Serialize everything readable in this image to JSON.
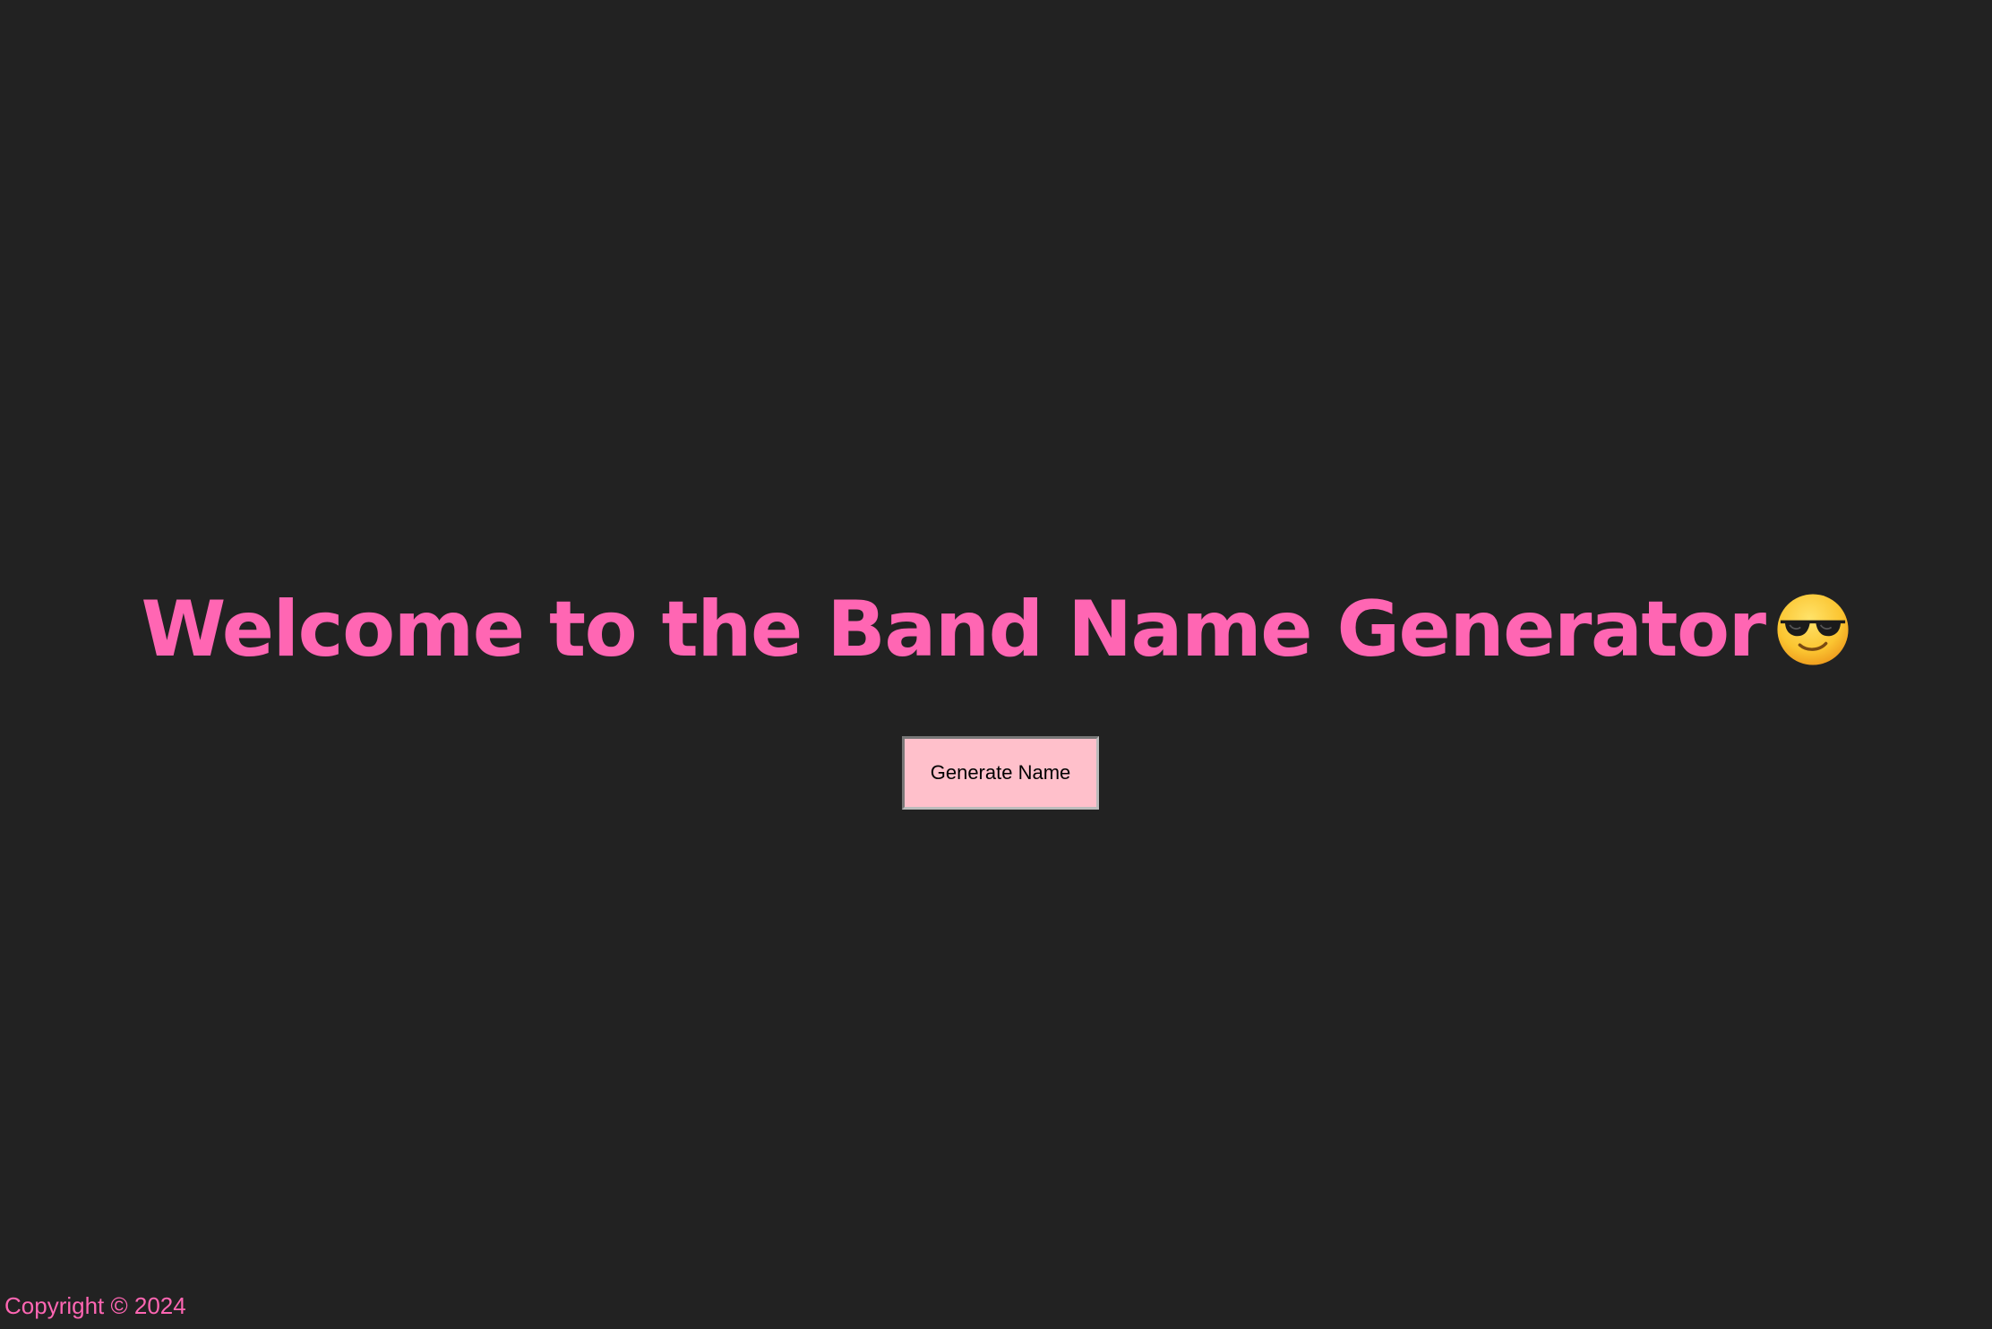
{
  "hero": {
    "title": "Welcome to the Band Name Generator",
    "emoji_icon": "smiling-face-with-sunglasses-icon"
  },
  "actions": {
    "generate_label": "Generate Name"
  },
  "footer": {
    "copyright": "Copyright © 2024"
  },
  "colors": {
    "background": "#222222",
    "accent": "#ff66b3",
    "button_bg": "#ffc0cb",
    "button_text": "#000000"
  }
}
